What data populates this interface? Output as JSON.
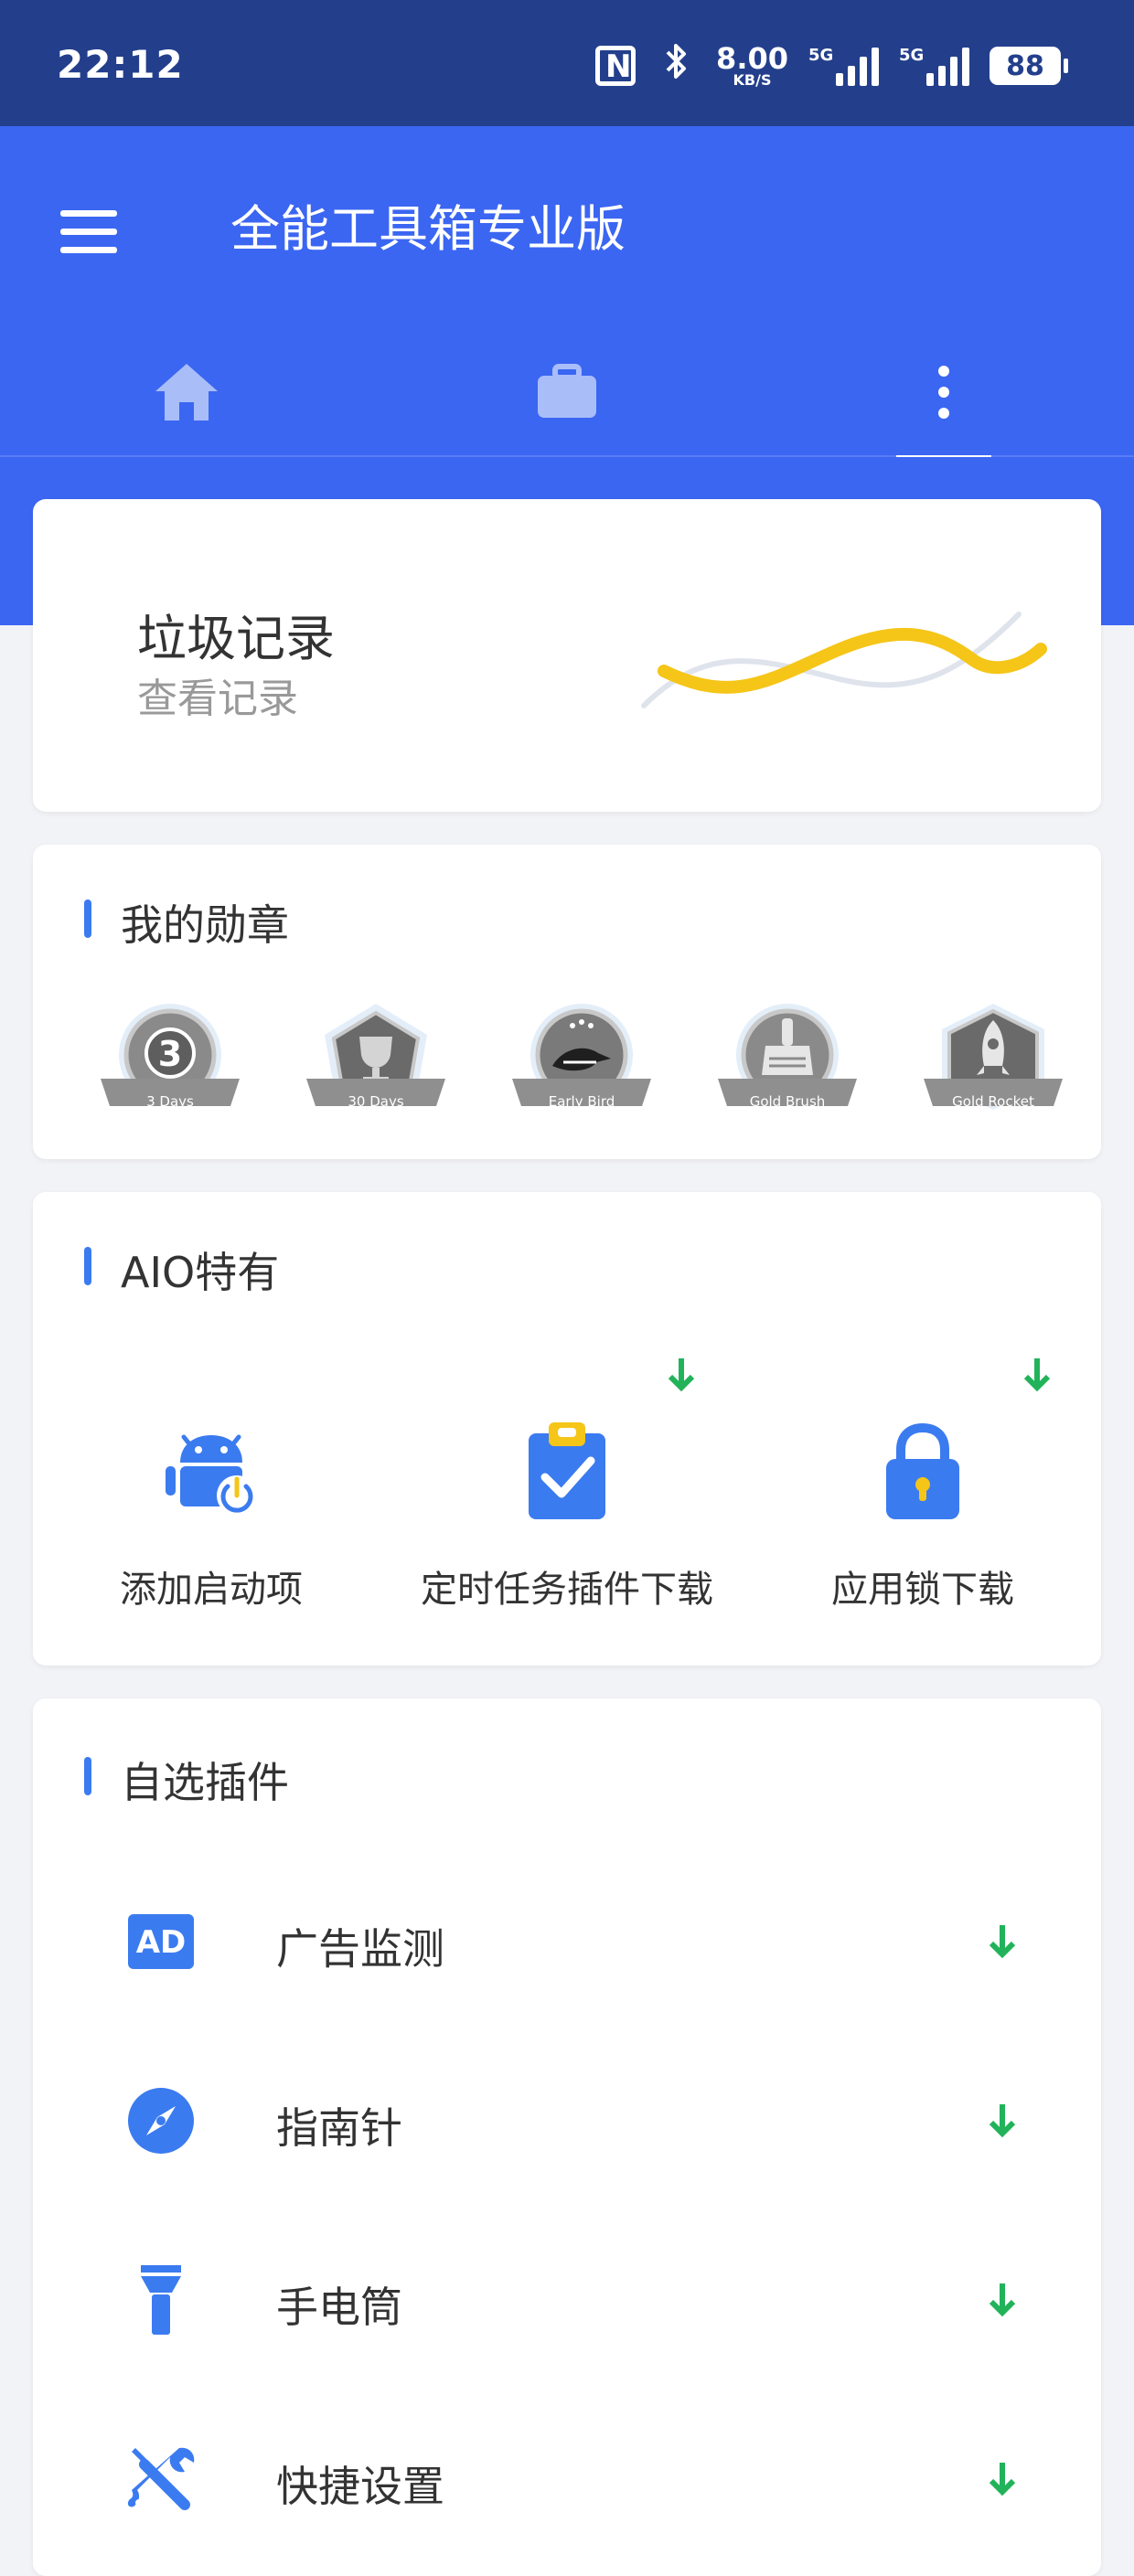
{
  "status_bar": {
    "time": "22:12",
    "speed_value": "8.00",
    "speed_unit": "KB/S",
    "signal1_tag": "5G",
    "signal2_tag": "5G",
    "battery": "88"
  },
  "header": {
    "title": "全能工具箱专业版",
    "tabs": [
      {
        "icon": "home-icon",
        "active": false
      },
      {
        "icon": "briefcase-icon",
        "active": false
      },
      {
        "icon": "more-vertical-icon",
        "active": true
      }
    ]
  },
  "junk_card": {
    "title": "垃圾记录",
    "subtitle": "查看记录"
  },
  "medals": {
    "title": "我的勋章",
    "items": [
      {
        "label": "3 Days",
        "center": "3"
      },
      {
        "label": "30 Days",
        "center": ""
      },
      {
        "label": "Early Bird",
        "center": ""
      },
      {
        "label": "Gold Brush",
        "center": ""
      },
      {
        "label": "Gold Rocket",
        "center": ""
      }
    ]
  },
  "aio": {
    "title": "AIO特有",
    "items": [
      {
        "label": "添加启动项",
        "icon": "android-power-icon",
        "download": false
      },
      {
        "label": "定时任务插件下载",
        "icon": "clipboard-check-icon",
        "download": true
      },
      {
        "label": "应用锁下载",
        "icon": "lock-icon",
        "download": true
      }
    ]
  },
  "plugins": {
    "title": "自选插件",
    "items": [
      {
        "label": "广告监测",
        "icon": "ad-icon",
        "icon_text": "AD"
      },
      {
        "label": "指南针",
        "icon": "compass-icon"
      },
      {
        "label": "手电筒",
        "icon": "flashlight-icon"
      },
      {
        "label": "快捷设置",
        "icon": "tools-icon"
      }
    ]
  },
  "colors": {
    "header_blue": "#3b66f2",
    "status_blue": "#233f8c",
    "icon_blue": "#3b7bf0",
    "download_green": "#22b35a",
    "wave_yellow": "#f5c518"
  }
}
